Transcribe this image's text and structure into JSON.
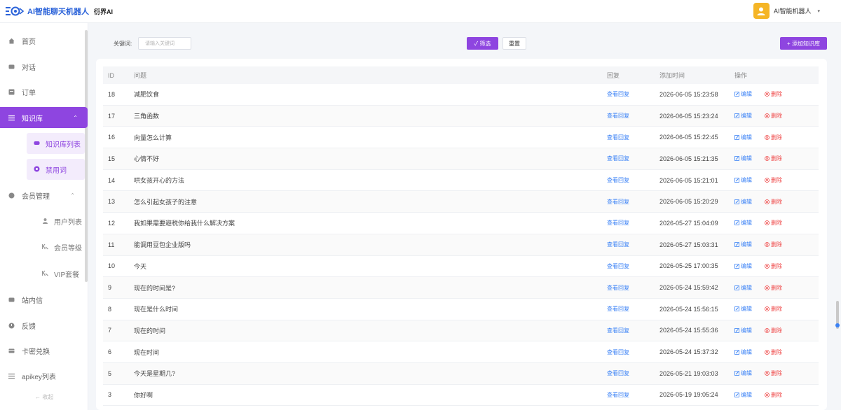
{
  "header": {
    "logo_text": "AI智能聊天机器人",
    "brand": "衍界AI",
    "user_name": "AI智能机器人",
    "caret": "▾"
  },
  "sidebar": {
    "items": [
      {
        "label": "首页",
        "icon": "home-icon"
      },
      {
        "label": "对话",
        "icon": "chat-icon"
      },
      {
        "label": "订单",
        "icon": "order-icon"
      },
      {
        "label": "知识库",
        "icon": "list-icon"
      },
      {
        "label": "会员管理",
        "icon": "member-icon"
      },
      {
        "label": "站内信",
        "icon": "message-icon"
      },
      {
        "label": "反馈",
        "icon": "feedback-icon"
      },
      {
        "label": "卡密兑换",
        "icon": "card-icon"
      },
      {
        "label": "apikey列表",
        "icon": "list-icon"
      }
    ],
    "knowledge_sub": [
      {
        "label": "知识库列表",
        "icon": "book-icon"
      },
      {
        "label": "禁用词",
        "icon": "ban-icon"
      }
    ],
    "member_sub": [
      {
        "label": "用户列表",
        "icon": "user-icon"
      },
      {
        "label": "会员等级",
        "icon": "vip-icon"
      },
      {
        "label": "VIP套餐",
        "icon": "vip-icon"
      }
    ],
    "collapse": "← 收起"
  },
  "filters": {
    "keyword_label": "关键词:",
    "keyword_placeholder": "请输入关键词",
    "filter_button": "✓ 筛选",
    "reset_button": "重置",
    "add_button": "+ 添加知识库"
  },
  "table": {
    "headers": {
      "id": "ID",
      "question": "问题",
      "reply": "回复",
      "time": "添加时间",
      "ops": "操作"
    },
    "reply_link": "查看回复",
    "edit_label": "编辑",
    "delete_label": "删除",
    "rows": [
      {
        "id": "18",
        "question": "减肥饮食",
        "time": "2026-06-05 15:23:58"
      },
      {
        "id": "17",
        "question": "三角函数",
        "time": "2026-06-05 15:23:24"
      },
      {
        "id": "16",
        "question": "向量怎么计算",
        "time": "2026-06-05 15:22:45"
      },
      {
        "id": "15",
        "question": "心情不好",
        "time": "2026-06-05 15:21:35"
      },
      {
        "id": "14",
        "question": "哄女孩开心的方法",
        "time": "2026-06-05 15:21:01"
      },
      {
        "id": "13",
        "question": "怎么引起女孩子的注意",
        "time": "2026-06-05 15:20:29"
      },
      {
        "id": "12",
        "question": "我如果需要避税你给我什么解决方案",
        "time": "2026-05-27 15:04:09"
      },
      {
        "id": "11",
        "question": "能调用豆包企业版吗",
        "time": "2026-05-27 15:03:31"
      },
      {
        "id": "10",
        "question": "今天",
        "time": "2026-05-25 17:00:35"
      },
      {
        "id": "9",
        "question": "现在的时间是?",
        "time": "2026-05-24 15:59:42"
      },
      {
        "id": "8",
        "question": "现在是什么时间",
        "time": "2026-05-24 15:56:15"
      },
      {
        "id": "7",
        "question": "现在的时间",
        "time": "2026-05-24 15:55:36"
      },
      {
        "id": "6",
        "question": "现在时间",
        "time": "2026-05-24 15:37:32"
      },
      {
        "id": "5",
        "question": "今天是星期几?",
        "time": "2026-05-21 19:03:03"
      },
      {
        "id": "3",
        "question": "你好啊",
        "time": "2026-05-19 19:05:24"
      }
    ]
  },
  "colors": {
    "accent": "#8e45e0",
    "link": "#3b82f6",
    "danger": "#ef4444",
    "avatar": "#f5b526"
  }
}
